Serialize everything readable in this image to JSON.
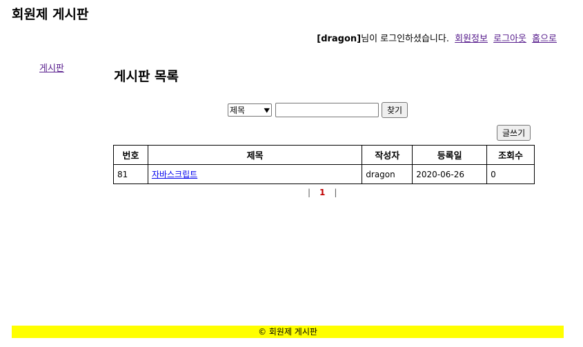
{
  "header": {
    "site_title": "회원제 게시판",
    "login_user": "[dragon]",
    "login_message": "님이 로그인하셨습니다.",
    "link_member_info": "회원정보",
    "link_logout": "로그아웃",
    "link_home": "홈으로"
  },
  "sidebar": {
    "board_link": "게시판"
  },
  "main": {
    "heading": "게시판 목록",
    "search": {
      "select_value": "제목",
      "input_value": "",
      "button_label": "찾기"
    },
    "write_button": "글쓰기",
    "table": {
      "headers": [
        "번호",
        "제목",
        "작성자",
        "등록일",
        "조회수"
      ],
      "rows": [
        {
          "no": "81",
          "title": "자바스크립트",
          "author": "dragon",
          "date": "2020-06-26",
          "views": "0"
        }
      ]
    },
    "pager": {
      "left_sep": "|",
      "current": "1",
      "right_sep": "|"
    }
  },
  "footer": {
    "text": "© 회원제 게시판"
  }
}
